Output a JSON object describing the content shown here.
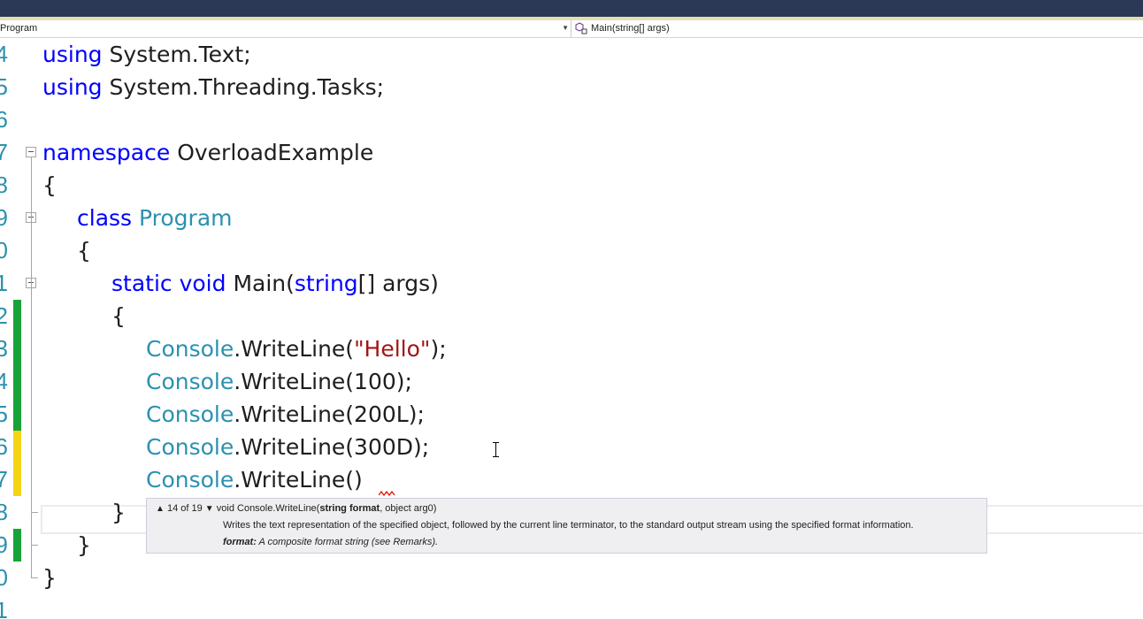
{
  "navbar": {
    "type_dropdown": "Program",
    "member_dropdown": "Main(string[] args)",
    "member_icon": "method-icon"
  },
  "editor": {
    "lines": [
      {
        "number": "4",
        "code": [
          {
            "t": "using",
            "c": "kw"
          },
          {
            "t": " System.Text;"
          }
        ]
      },
      {
        "number": "5",
        "code": [
          {
            "t": "using",
            "c": "kw"
          },
          {
            "t": " System.Threading.Tasks;"
          }
        ]
      },
      {
        "number": "6",
        "code": []
      },
      {
        "number": "7",
        "collapse": true,
        "code": [
          {
            "t": "namespace",
            "c": "kw"
          },
          {
            "t": " OverloadExample"
          }
        ]
      },
      {
        "number": "8",
        "code": [
          {
            "t": "{"
          }
        ]
      },
      {
        "number": "9",
        "collapse": true,
        "code": [
          {
            "t": "class",
            "c": "kw"
          },
          {
            "t": " "
          },
          {
            "t": "Program",
            "c": "type"
          }
        ]
      },
      {
        "number": "0",
        "code": [
          {
            "t": "{"
          }
        ]
      },
      {
        "number": "1",
        "collapse": true,
        "code": [
          {
            "t": "static",
            "c": "kw"
          },
          {
            "t": " "
          },
          {
            "t": "void",
            "c": "kw"
          },
          {
            "t": " Main("
          },
          {
            "t": "string",
            "c": "kw"
          },
          {
            "t": "[] args)"
          }
        ]
      },
      {
        "number": "2",
        "change": "saved",
        "code": [
          {
            "t": "{"
          }
        ]
      },
      {
        "number": "3",
        "change": "saved",
        "code": [
          {
            "t": "Console",
            "c": "type"
          },
          {
            "t": ".WriteLine("
          },
          {
            "t": "\"Hello\"",
            "c": "str"
          },
          {
            "t": ");"
          }
        ]
      },
      {
        "number": "4",
        "change": "saved",
        "code": [
          {
            "t": "Console",
            "c": "type"
          },
          {
            "t": ".WriteLine(100);"
          }
        ]
      },
      {
        "number": "5",
        "change": "saved",
        "code": [
          {
            "t": "Console",
            "c": "type"
          },
          {
            "t": ".WriteLine(200L);"
          }
        ]
      },
      {
        "number": "6",
        "change": "unsaved",
        "code": [
          {
            "t": "Console",
            "c": "type"
          },
          {
            "t": ".WriteLine(300D);"
          }
        ]
      },
      {
        "number": "7",
        "change": "unsaved",
        "current": true,
        "code": [
          {
            "t": "Console",
            "c": "type"
          },
          {
            "t": ".WriteLine()"
          }
        ]
      },
      {
        "number": "8",
        "code": [
          {
            "t": "}"
          }
        ]
      },
      {
        "number": "9",
        "change": "saved",
        "code": [
          {
            "t": "}"
          }
        ]
      },
      {
        "number": "0",
        "code": [
          {
            "t": "}"
          }
        ]
      },
      {
        "number": "1",
        "code": []
      }
    ]
  },
  "tooltip": {
    "overload_counter": "14 of 19",
    "up_arrow": "▲",
    "down_arrow": "▼",
    "signature_prefix": "void Console.WriteLine(",
    "param_current": "string format",
    "signature_suffix": ", object arg0)",
    "description": "Writes the text representation of the specified object, followed by the current line terminator, to the standard output stream using the specified format information.",
    "param_name": "format:",
    "param_description": "A composite format string (see Remarks)."
  },
  "colors": {
    "keyword": "#0000ff",
    "type": "#2b91af",
    "string": "#a31515",
    "line_number": "#2b91af",
    "change_saved": "#18a339",
    "change_unsaved": "#f5d317",
    "titlebar": "#2b3956"
  }
}
